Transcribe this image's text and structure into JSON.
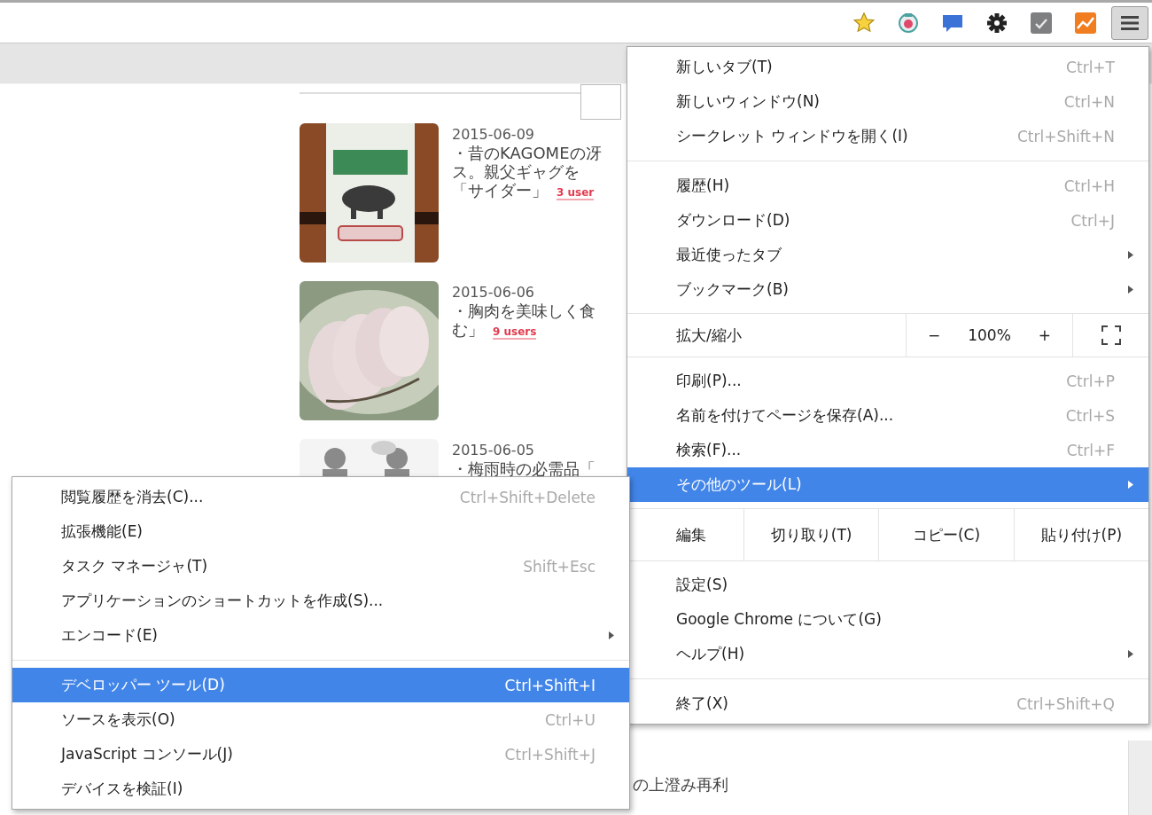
{
  "toolbar": {
    "menu_button": {
      "pressed": true
    }
  },
  "articles": [
    {
      "date": "2015-06-09",
      "lines": [
        "・昔のKAGOMEの冴",
        "ス。親父ギャグを",
        "「サイダー」"
      ],
      "users": "3 user",
      "kind": "picture"
    },
    {
      "date": "2015-06-06",
      "lines": [
        "・胸肉を美味しく食",
        "む」"
      ],
      "users": "9 users",
      "kind": "picture"
    },
    {
      "date": "2015-06-05",
      "lines": [
        "・梅雨時の必需品「"
      ],
      "kind": "picture"
    }
  ],
  "fragment": {
    "text": "の上澄み再利"
  },
  "main_menu": {
    "sections": [
      {
        "items": [
          {
            "kind": "command",
            "label": "新しいタブ(T)",
            "shortcut": "Ctrl+T",
            "submenu": false,
            "selected": false
          },
          {
            "kind": "command",
            "label": "新しいウィンドウ(N)",
            "shortcut": "Ctrl+N",
            "submenu": false,
            "selected": false
          },
          {
            "kind": "command",
            "label": "シークレット ウィンドウを開く(I)",
            "shortcut": "Ctrl+Shift+N",
            "submenu": false,
            "selected": false
          }
        ]
      },
      {
        "items": [
          {
            "kind": "command",
            "label": "履歴(H)",
            "shortcut": "Ctrl+H",
            "submenu": false,
            "selected": false
          },
          {
            "kind": "command",
            "label": "ダウンロード(D)",
            "shortcut": "Ctrl+J",
            "submenu": false,
            "selected": false
          },
          {
            "kind": "command",
            "label": "最近使ったタブ",
            "submenu": true,
            "selected": false
          },
          {
            "kind": "command",
            "label": "ブックマーク(B)",
            "submenu": true,
            "selected": false
          }
        ]
      },
      {
        "items": [
          {
            "kind": "zoom",
            "label": "拡大/縮小",
            "minus": "−",
            "value": "100%",
            "plus": "+"
          }
        ]
      },
      {
        "items": [
          {
            "kind": "command",
            "label": "印刷(P)...",
            "shortcut": "Ctrl+P",
            "submenu": false,
            "selected": false
          },
          {
            "kind": "command",
            "label": "名前を付けてページを保存(A)...",
            "shortcut": "Ctrl+S",
            "submenu": false,
            "selected": false
          },
          {
            "kind": "command",
            "label": "検索(F)...",
            "shortcut": "Ctrl+F",
            "submenu": false,
            "selected": false
          },
          {
            "kind": "command",
            "label": "その他のツール(L)",
            "submenu": true,
            "selected": true
          }
        ]
      },
      {
        "items": [
          {
            "kind": "edit",
            "label": "編集",
            "buttons": [
              "切り取り(T)",
              "コピー(C)",
              "貼り付け(P)"
            ]
          }
        ]
      },
      {
        "items": [
          {
            "kind": "command",
            "label": "設定(S)",
            "submenu": false,
            "selected": false
          },
          {
            "kind": "command",
            "label": "Google Chrome について(G)",
            "submenu": false,
            "selected": false
          },
          {
            "kind": "command",
            "label": "ヘルプ(H)",
            "submenu": true,
            "selected": false
          }
        ]
      },
      {
        "items": [
          {
            "kind": "command",
            "label": "終了(X)",
            "shortcut": "Ctrl+Shift+Q",
            "submenu": false,
            "selected": false
          }
        ]
      }
    ]
  },
  "submenu": {
    "sections": [
      {
        "items": [
          {
            "kind": "command",
            "label": "閲覧履歴を消去(C)...",
            "shortcut": "Ctrl+Shift+Delete",
            "submenu": false,
            "selected": false
          },
          {
            "kind": "command",
            "label": "拡張機能(E)",
            "submenu": false,
            "selected": false
          },
          {
            "kind": "command",
            "label": "タスク マネージャ(T)",
            "shortcut": "Shift+Esc",
            "submenu": false,
            "selected": false
          },
          {
            "kind": "command",
            "label": "アプリケーションのショートカットを作成(S)...",
            "submenu": false,
            "selected": false
          },
          {
            "kind": "command",
            "label": "エンコード(E)",
            "submenu": true,
            "selected": false
          }
        ]
      },
      {
        "items": [
          {
            "kind": "command",
            "label": "デベロッパー ツール(D)",
            "shortcut": "Ctrl+Shift+I",
            "submenu": false,
            "selected": true
          },
          {
            "kind": "command",
            "label": "ソースを表示(O)",
            "shortcut": "Ctrl+U",
            "submenu": false,
            "selected": false
          },
          {
            "kind": "command",
            "label": "JavaScript コンソール(J)",
            "shortcut": "Ctrl+Shift+J",
            "submenu": false,
            "selected": false
          },
          {
            "kind": "command",
            "label": "デバイスを検証(I)",
            "submenu": false,
            "selected": false
          }
        ]
      }
    ]
  }
}
